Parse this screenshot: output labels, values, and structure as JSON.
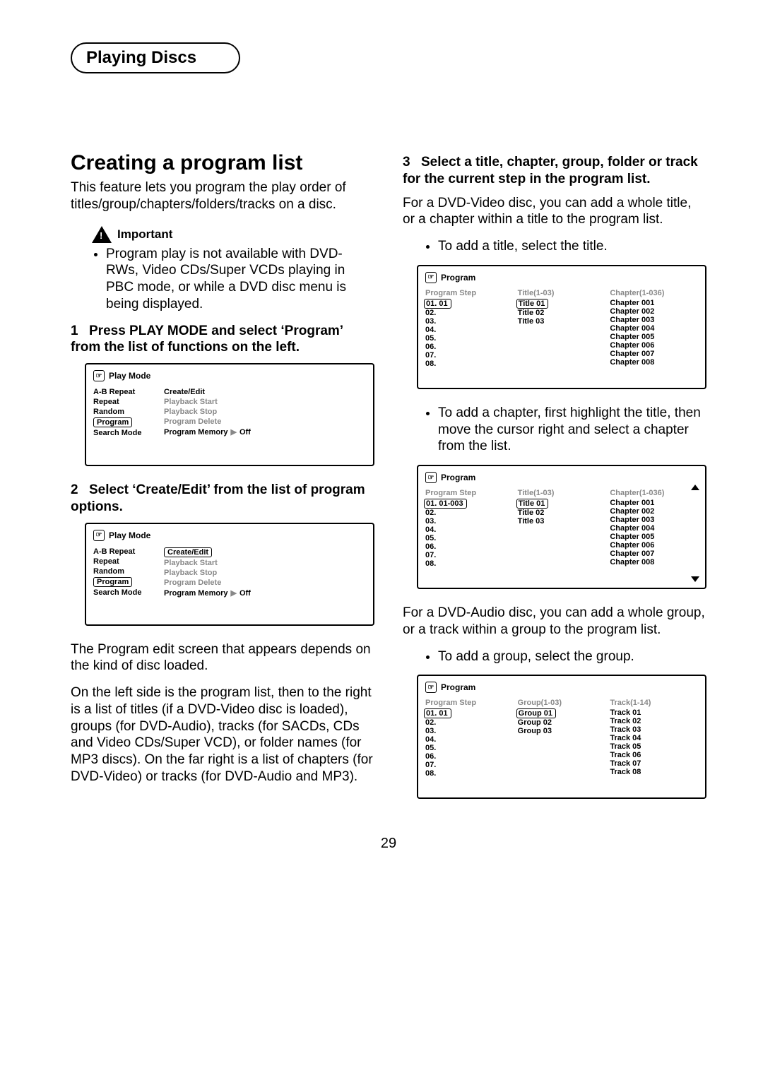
{
  "section_tab": "Playing Discs",
  "page_number": "29",
  "left": {
    "title": "Creating a program list",
    "intro": "This feature lets you program the play order of titles/group/chapters/folders/tracks on a disc.",
    "important_label": "Important",
    "important_bullet": "Program play is not available with DVD-RWs, Video CDs/Super VCDs playing in PBC mode, or while a DVD disc menu is being displayed.",
    "step1_num": "1",
    "step1_head": "Press PLAY MODE and select ‘Program’ from the list of functions on the left.",
    "step2_num": "2",
    "step2_head": "Select ‘Create/Edit’ from the list of program options.",
    "para_after_osd2a": "The Program edit screen that appears depends on the kind of disc loaded.",
    "para_after_osd2b": "On the left side is the program list, then to the right is a list of titles (if a DVD-Video disc is loaded), groups (for DVD-Audio), tracks (for SACDs, CDs and Video CDs/Super VCD), or folder names (for MP3 discs). On the far right is a list of chapters (for DVD-Video) or tracks (for DVD-Audio and MP3).",
    "osd_playmode": {
      "title": "Play Mode",
      "left_items": [
        "A-B Repeat",
        "Repeat",
        "Random",
        "Program",
        "Search Mode"
      ],
      "right_items": [
        "Create/Edit",
        "Playback Start",
        "Playback Stop",
        "Program Delete",
        "Program Memory"
      ],
      "memory_state": "Off"
    }
  },
  "right": {
    "step3_num": "3",
    "step3_head": "Select a title, chapter, group, folder or track for the current step in the program list.",
    "para3a": "For a DVD-Video disc, you can add a whole title, or a chapter within a title to the program list.",
    "bullet_title": "To add a title, select the title.",
    "bullet_chapter": "To add a chapter, first highlight the title, then move the cursor right and select a chapter from the list.",
    "para3b": "For a DVD-Audio disc, you can add a whole group, or a track within a group to the program list.",
    "bullet_group": "To add a group, select the group.",
    "osd_program": {
      "title": "Program",
      "head_step": "Program Step",
      "head_title": "Title(1-03)",
      "head_chapter": "Chapter(1-036)",
      "head_group": "Group(1-03)",
      "head_track": "Track(1-14)",
      "steps": [
        "01. 01",
        "02.",
        "03.",
        "04.",
        "05.",
        "06.",
        "07.",
        "08."
      ],
      "steps_chapter": [
        "01. 01-003",
        "02.",
        "03.",
        "04.",
        "05.",
        "06.",
        "07.",
        "08."
      ],
      "titles": [
        "Title 01",
        "Title 02",
        "Title 03"
      ],
      "chapters": [
        "Chapter 001",
        "Chapter 002",
        "Chapter 003",
        "Chapter 004",
        "Chapter 005",
        "Chapter 006",
        "Chapter 007",
        "Chapter 008"
      ],
      "groups": [
        "Group 01",
        "Group 02",
        "Group 03"
      ],
      "tracks": [
        "Track 01",
        "Track 02",
        "Track 03",
        "Track 04",
        "Track 05",
        "Track 06",
        "Track 07",
        "Track 08"
      ]
    }
  }
}
